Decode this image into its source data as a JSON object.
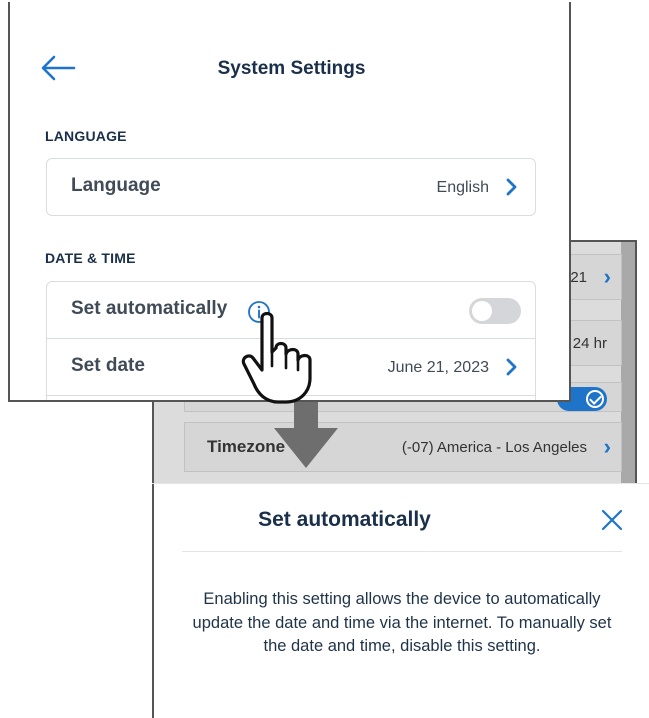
{
  "background_screen": {
    "row1_value": "21",
    "row2_value": "24 hr",
    "timezone_label": "Timezone",
    "timezone_value": "(-07) America - Los Angeles"
  },
  "main": {
    "title": "System Settings",
    "section_language": "LANGUAGE",
    "language_label": "Language",
    "language_value": "English",
    "section_datetime": "DATE & TIME",
    "set_auto_label": "Set automatically",
    "set_auto_toggle": "off",
    "set_date_label": "Set date",
    "set_date_value": "June 21, 2023"
  },
  "dialog": {
    "title": "Set automatically",
    "body": "Enabling this setting allows the device to automatically update the date and time via the internet. To manually set the date and time, disable this setting."
  },
  "colors": {
    "accent": "#1d74c8",
    "text_dark": "#1a2f4a",
    "label_gray": "#404b57",
    "toggle_off": "#d4d6d9"
  },
  "icons": [
    "back-arrow-icon",
    "chevron-right-icon",
    "info-icon",
    "close-icon",
    "hand-pointer-icon",
    "down-arrow-icon",
    "checkmark-icon"
  ]
}
